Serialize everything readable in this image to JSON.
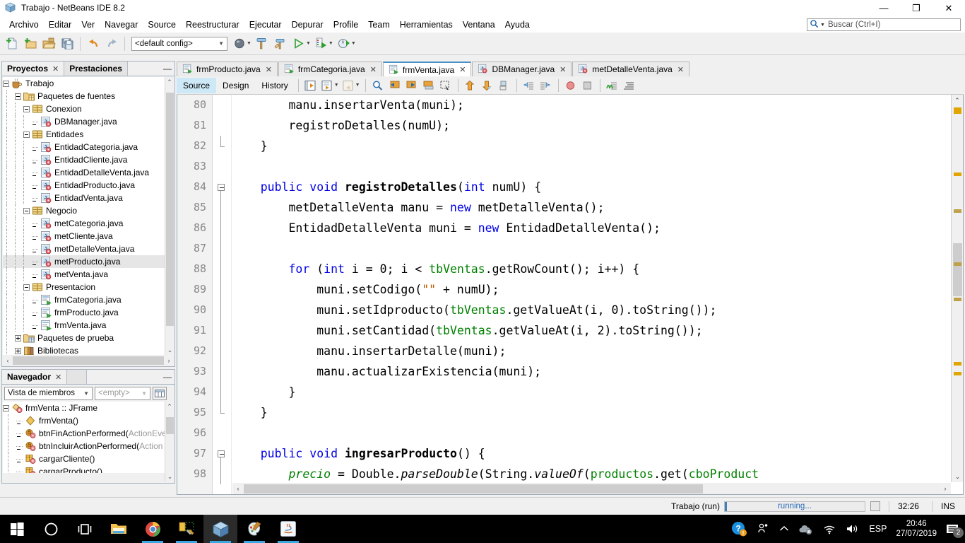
{
  "window": {
    "title": "Trabajo - NetBeans IDE 8.2",
    "app_icon": "cube-icon",
    "minimize": "—",
    "maximize": "❐",
    "close": "✕"
  },
  "menubar": {
    "items": [
      "Archivo",
      "Editar",
      "Ver",
      "Navegar",
      "Source",
      "Reestructurar",
      "Ejecutar",
      "Depurar",
      "Profile",
      "Team",
      "Herramientas",
      "Ventana",
      "Ayuda"
    ],
    "search_placeholder": "Buscar (Ctrl+I)"
  },
  "toolbar": {
    "buttons": [
      "new-file-icon",
      "new-project-icon",
      "open-project-icon",
      "save-all-icon",
      "undo-icon",
      "redo-icon"
    ],
    "config_value": "<default config>",
    "run_buttons": [
      "build-main-project-icon",
      "clean-build-icon",
      "clean-and-build-icon",
      "run-project-icon",
      "debug-project-icon",
      "profile-project-icon"
    ]
  },
  "projects_panel": {
    "tabs": [
      {
        "label": "Proyectos",
        "active": true,
        "closable": true
      },
      {
        "label": "Prestaciones",
        "active": false,
        "closable": false
      }
    ],
    "minimize": "—",
    "tree": [
      {
        "label": "Trabajo",
        "depth": 0,
        "twisty": "minus",
        "icon": "coffee-cup-icon",
        "selected": false
      },
      {
        "label": "Paquetes de fuentes",
        "depth": 1,
        "twisty": "minus",
        "icon": "source-packages-icon",
        "selected": false
      },
      {
        "label": "Conexion",
        "depth": 2,
        "twisty": "minus",
        "icon": "package-icon",
        "selected": false
      },
      {
        "label": "DBManager.java",
        "depth": 3,
        "twisty": "none",
        "icon": "java-class-icon",
        "selected": false
      },
      {
        "label": "Entidades",
        "depth": 2,
        "twisty": "minus",
        "icon": "package-icon",
        "selected": false
      },
      {
        "label": "EntidadCategoria.java",
        "depth": 3,
        "twisty": "none",
        "icon": "java-class-icon",
        "selected": false
      },
      {
        "label": "EntidadCliente.java",
        "depth": 3,
        "twisty": "none",
        "icon": "java-class-icon",
        "selected": false
      },
      {
        "label": "EntidadDetalleVenta.java",
        "depth": 3,
        "twisty": "none",
        "icon": "java-class-icon",
        "selected": false
      },
      {
        "label": "EntidadProducto.java",
        "depth": 3,
        "twisty": "none",
        "icon": "java-class-icon",
        "selected": false
      },
      {
        "label": "EntidadVenta.java",
        "depth": 3,
        "twisty": "none",
        "icon": "java-class-icon",
        "selected": false
      },
      {
        "label": "Negocio",
        "depth": 2,
        "twisty": "minus",
        "icon": "package-icon",
        "selected": false
      },
      {
        "label": "metCategoria.java",
        "depth": 3,
        "twisty": "none",
        "icon": "java-class-icon",
        "selected": false
      },
      {
        "label": "metCliente.java",
        "depth": 3,
        "twisty": "none",
        "icon": "java-class-icon",
        "selected": false
      },
      {
        "label": "metDetalleVenta.java",
        "depth": 3,
        "twisty": "none",
        "icon": "java-class-icon",
        "selected": false
      },
      {
        "label": "metProducto.java",
        "depth": 3,
        "twisty": "none",
        "icon": "java-class-icon",
        "selected": true
      },
      {
        "label": "metVenta.java",
        "depth": 3,
        "twisty": "none",
        "icon": "java-class-icon",
        "selected": false
      },
      {
        "label": "Presentacion",
        "depth": 2,
        "twisty": "minus",
        "icon": "package-icon",
        "selected": false
      },
      {
        "label": "frmCategoria.java",
        "depth": 3,
        "twisty": "none",
        "icon": "java-form-icon",
        "selected": false
      },
      {
        "label": "frmProducto.java",
        "depth": 3,
        "twisty": "none",
        "icon": "java-form-icon",
        "selected": false
      },
      {
        "label": "frmVenta.java",
        "depth": 3,
        "twisty": "none",
        "icon": "java-form-icon",
        "selected": false
      },
      {
        "label": "Paquetes de prueba",
        "depth": 1,
        "twisty": "plus",
        "icon": "test-packages-icon",
        "selected": false
      },
      {
        "label": "Bibliotecas",
        "depth": 1,
        "twisty": "plus",
        "icon": "libraries-icon",
        "selected": false
      }
    ]
  },
  "navigator_panel": {
    "title": "Navegador",
    "close": "✕",
    "minimize": "—",
    "view_select": "Vista de miembros",
    "filter_select": "<empty>",
    "tree": [
      {
        "label": "frmVenta :: JFrame",
        "suffix": "",
        "depth": 0,
        "twisty": "minus",
        "icon": "class-jframe-icon"
      },
      {
        "label": "frmVenta()",
        "suffix": "",
        "depth": 1,
        "twisty": "none",
        "icon": "constructor-icon"
      },
      {
        "label": "btnFinActionPerformed(",
        "suffix": "ActionEve",
        "depth": 1,
        "twisty": "none",
        "icon": "method-private-icon"
      },
      {
        "label": "btnIncluirActionPerformed(",
        "suffix": "Action",
        "depth": 1,
        "twisty": "none",
        "icon": "method-private-icon"
      },
      {
        "label": "cargarCliente()",
        "suffix": "",
        "depth": 1,
        "twisty": "none",
        "icon": "method-package-icon"
      },
      {
        "label": "cargarProducto()",
        "suffix": "",
        "depth": 1,
        "twisty": "none",
        "icon": "method-package-icon"
      }
    ]
  },
  "editor": {
    "doc_tabs": [
      {
        "label": "frmProducto.java",
        "icon": "java-form-icon",
        "active": false
      },
      {
        "label": "frmCategoria.java",
        "icon": "java-form-icon",
        "active": false
      },
      {
        "label": "frmVenta.java",
        "icon": "java-form-icon",
        "active": true
      },
      {
        "label": "DBManager.java",
        "icon": "java-class-icon",
        "active": false
      },
      {
        "label": "metDetalleVenta.java",
        "icon": "java-class-icon",
        "active": false
      }
    ],
    "tab_nav": [
      "scroll-left-icon",
      "scroll-right-icon",
      "tab-list-icon",
      "maximize-window-icon"
    ],
    "view_tabs": [
      {
        "label": "Source",
        "active": true
      },
      {
        "label": "Design",
        "active": false
      },
      {
        "label": "History",
        "active": false
      }
    ],
    "tool_icons": [
      "last-edit-icon",
      "back-icon",
      "forward-icon",
      "find-selection-icon",
      "previous-bookmark-icon",
      "next-bookmark-icon",
      "toggle-bookmark-icon",
      "toggle-rectangular-selection-icon",
      "previous-error-icon",
      "next-error-icon",
      "shift-line-icon",
      "shift-left-icon",
      "shift-right-icon",
      "toggle-breakpoint-icon",
      "stop-icon",
      "toggle-highlight-icon",
      "inspect-icon"
    ],
    "first_line": 80,
    "lines": [
      {
        "n": 80,
        "fold": "",
        "tokens": [
          {
            "t": "        manu.insertarVenta(muni);",
            "c": "plain"
          }
        ]
      },
      {
        "n": 81,
        "fold": "",
        "tokens": [
          {
            "t": "        registroDetalles(numU);",
            "c": "plain"
          }
        ]
      },
      {
        "n": 82,
        "fold": "end",
        "tokens": [
          {
            "t": "    }",
            "c": "plain"
          }
        ]
      },
      {
        "n": 83,
        "fold": "",
        "tokens": [
          {
            "t": "",
            "c": "plain"
          }
        ]
      },
      {
        "n": 84,
        "fold": "start",
        "tokens": [
          {
            "t": "    ",
            "c": "plain"
          },
          {
            "t": "public",
            "c": "kw"
          },
          {
            "t": " ",
            "c": "plain"
          },
          {
            "t": "void",
            "c": "kw"
          },
          {
            "t": " ",
            "c": "plain"
          },
          {
            "t": "registroDetalles",
            "c": "kwb"
          },
          {
            "t": "(",
            "c": "plain"
          },
          {
            "t": "int",
            "c": "kw"
          },
          {
            "t": " numU) {",
            "c": "plain"
          }
        ]
      },
      {
        "n": 85,
        "fold": "bar",
        "tokens": [
          {
            "t": "        metDetalleVenta manu = ",
            "c": "plain"
          },
          {
            "t": "new",
            "c": "kw"
          },
          {
            "t": " metDetalleVenta();",
            "c": "plain"
          }
        ]
      },
      {
        "n": 86,
        "fold": "bar",
        "tokens": [
          {
            "t": "        EntidadDetalleVenta muni = ",
            "c": "plain"
          },
          {
            "t": "new",
            "c": "kw"
          },
          {
            "t": " EntidadDetalleVenta();",
            "c": "plain"
          }
        ]
      },
      {
        "n": 87,
        "fold": "bar",
        "tokens": [
          {
            "t": "",
            "c": "plain"
          }
        ]
      },
      {
        "n": 88,
        "fold": "bar",
        "tokens": [
          {
            "t": "        ",
            "c": "plain"
          },
          {
            "t": "for",
            "c": "kw"
          },
          {
            "t": " (",
            "c": "plain"
          },
          {
            "t": "int",
            "c": "kw"
          },
          {
            "t": " i = 0; i < ",
            "c": "plain"
          },
          {
            "t": "tbVentas",
            "c": "fld"
          },
          {
            "t": ".getRowCount(); i++) {",
            "c": "plain"
          }
        ]
      },
      {
        "n": 89,
        "fold": "bar",
        "tokens": [
          {
            "t": "            muni.setCodigo(",
            "c": "plain"
          },
          {
            "t": "\"\"",
            "c": "str"
          },
          {
            "t": " + numU);",
            "c": "plain"
          }
        ]
      },
      {
        "n": 90,
        "fold": "bar",
        "tokens": [
          {
            "t": "            muni.setIdproducto(",
            "c": "plain"
          },
          {
            "t": "tbVentas",
            "c": "fld"
          },
          {
            "t": ".getValueAt(i, 0).toString());",
            "c": "plain"
          }
        ]
      },
      {
        "n": 91,
        "fold": "bar",
        "tokens": [
          {
            "t": "            muni.setCantidad(",
            "c": "plain"
          },
          {
            "t": "tbVentas",
            "c": "fld"
          },
          {
            "t": ".getValueAt(i, 2).toString());",
            "c": "plain"
          }
        ]
      },
      {
        "n": 92,
        "fold": "bar",
        "tokens": [
          {
            "t": "            manu.insertarDetalle(muni);",
            "c": "plain"
          }
        ]
      },
      {
        "n": 93,
        "fold": "bar",
        "tokens": [
          {
            "t": "            manu.actualizarExistencia(muni);",
            "c": "plain"
          }
        ]
      },
      {
        "n": 94,
        "fold": "bar",
        "tokens": [
          {
            "t": "        }",
            "c": "plain"
          }
        ]
      },
      {
        "n": 95,
        "fold": "end",
        "tokens": [
          {
            "t": "    }",
            "c": "plain"
          }
        ]
      },
      {
        "n": 96,
        "fold": "",
        "tokens": [
          {
            "t": "",
            "c": "plain"
          }
        ]
      },
      {
        "n": 97,
        "fold": "start",
        "tokens": [
          {
            "t": "    ",
            "c": "plain"
          },
          {
            "t": "public",
            "c": "kw"
          },
          {
            "t": " ",
            "c": "plain"
          },
          {
            "t": "void",
            "c": "kw"
          },
          {
            "t": " ",
            "c": "plain"
          },
          {
            "t": "ingresarProducto",
            "c": "kwb"
          },
          {
            "t": "() {",
            "c": "plain"
          }
        ]
      },
      {
        "n": 98,
        "fold": "bar",
        "tokens": [
          {
            "t": "        ",
            "c": "plain"
          },
          {
            "t": "precio",
            "c": "fldi"
          },
          {
            "t": " = Double.",
            "c": "plain"
          },
          {
            "t": "parseDouble",
            "c": "itl"
          },
          {
            "t": "(String.",
            "c": "plain"
          },
          {
            "t": "valueOf",
            "c": "itl"
          },
          {
            "t": "(",
            "c": "plain"
          },
          {
            "t": "productos",
            "c": "fld"
          },
          {
            "t": ".get(",
            "c": "plain"
          },
          {
            "t": "cboProduct",
            "c": "fld"
          }
        ]
      }
    ]
  },
  "statusbar": {
    "task_label": "Trabajo (run)",
    "progress_label": "running...",
    "time": "32:26",
    "insert_mode": "INS"
  },
  "taskbar": {
    "items": [
      {
        "name": "start-button-icon",
        "active": false,
        "running": false
      },
      {
        "name": "cortana-search-icon",
        "active": false,
        "running": false
      },
      {
        "name": "task-view-icon",
        "active": false,
        "running": false
      },
      {
        "name": "file-explorer-icon",
        "active": false,
        "running": false
      },
      {
        "name": "google-chrome-icon",
        "active": false,
        "running": true
      },
      {
        "name": "sql-tools-icon",
        "active": false,
        "running": true
      },
      {
        "name": "netbeans-icon",
        "active": true,
        "running": true
      },
      {
        "name": "paint-icon",
        "active": false,
        "running": true
      },
      {
        "name": "java-app-icon",
        "active": false,
        "running": true
      }
    ],
    "tray": {
      "help_icon": "help-circle-icon",
      "people_icon": "people-icon",
      "chevron_icon": "show-hidden-icons-icon",
      "onedrive_icon": "cloud-sync-icon",
      "network_icon": "wifi-icon",
      "volume_icon": "speaker-icon",
      "language": "ESP",
      "time": "20:46",
      "date": "27/07/2019",
      "notification_count": "2"
    }
  },
  "colors": {
    "accent": "#4a90c4",
    "keyword": "#0000e6",
    "field": "#008000",
    "string": "#b35900",
    "selection": "#cde8f6",
    "taskbar": "#000000"
  }
}
